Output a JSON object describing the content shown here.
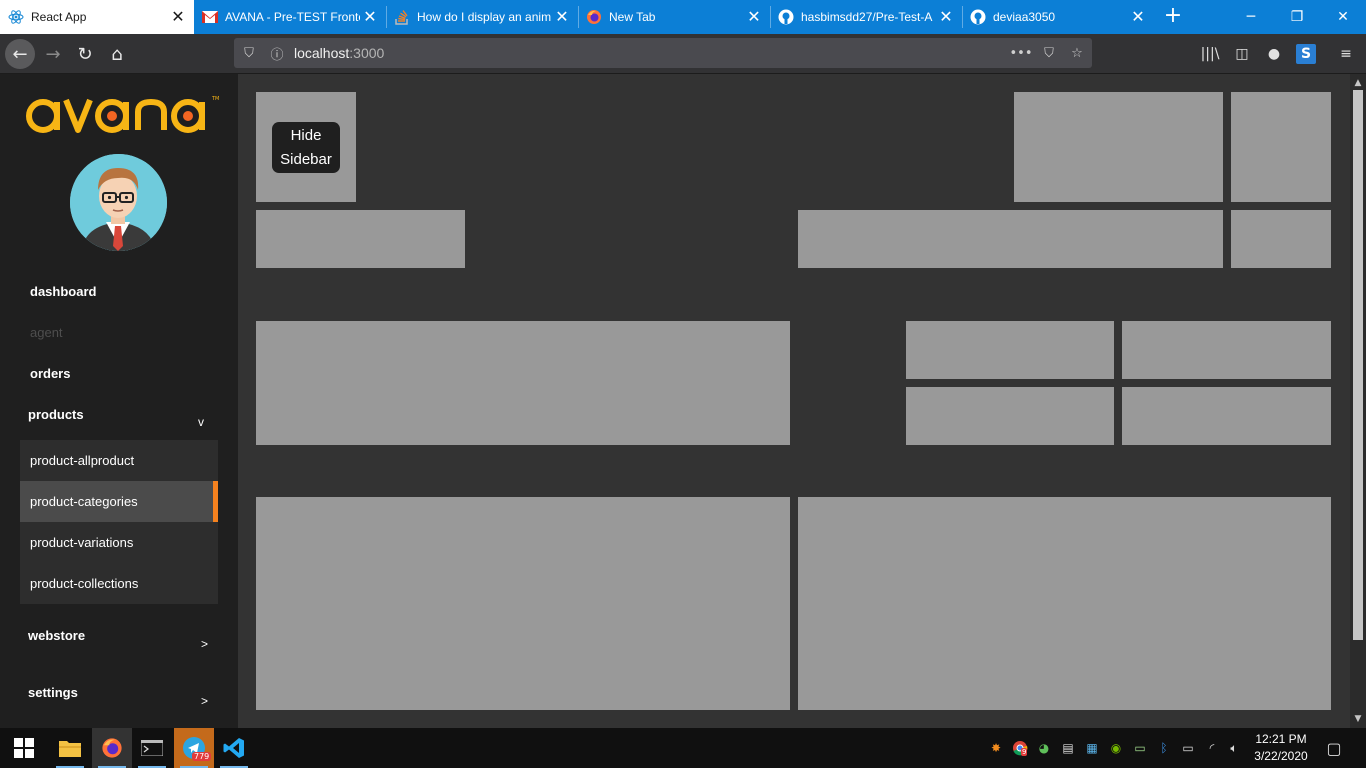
{
  "browser": {
    "tabs": [
      {
        "label": "React App",
        "icon": "react-icon",
        "active": true
      },
      {
        "label": "AVANA - Pre-TEST Fronte",
        "icon": "gmail-icon"
      },
      {
        "label": "How do I display an anim",
        "icon": "stackoverflow-icon"
      },
      {
        "label": "New Tab",
        "icon": "firefox-icon"
      },
      {
        "label": "hasbimsdd27/Pre-Test-A",
        "icon": "github-icon"
      },
      {
        "label": "deviaa3050",
        "icon": "github-icon"
      }
    ],
    "url_host": "localhost",
    "url_port": ":3000"
  },
  "sidebar": {
    "logo_text": "avana",
    "menu": {
      "dashboard": "dashboard",
      "agent": "agent",
      "orders": "orders",
      "products": "products",
      "products_arrow": "v",
      "webstore": "webstore",
      "webstore_arrow": ">",
      "settings": "settings",
      "settings_arrow": ">"
    },
    "submenu": [
      {
        "label": "product-allproduct"
      },
      {
        "label": "product-categories",
        "active": true
      },
      {
        "label": "product-variations"
      },
      {
        "label": "product-collections"
      }
    ]
  },
  "main": {
    "hide_button_line1": "Hide",
    "hide_button_line2": "Sidebar"
  },
  "taskbar": {
    "telegram_badge": "779",
    "avast_badge": "9",
    "time": "12:21 PM",
    "date": "3/22/2020"
  },
  "colors": {
    "accent": "#f5821f",
    "tab_blue": "#0c7fd6",
    "placeholder_box": "#999999",
    "logo_yellow": "#f7b515",
    "logo_orange": "#f26522"
  }
}
